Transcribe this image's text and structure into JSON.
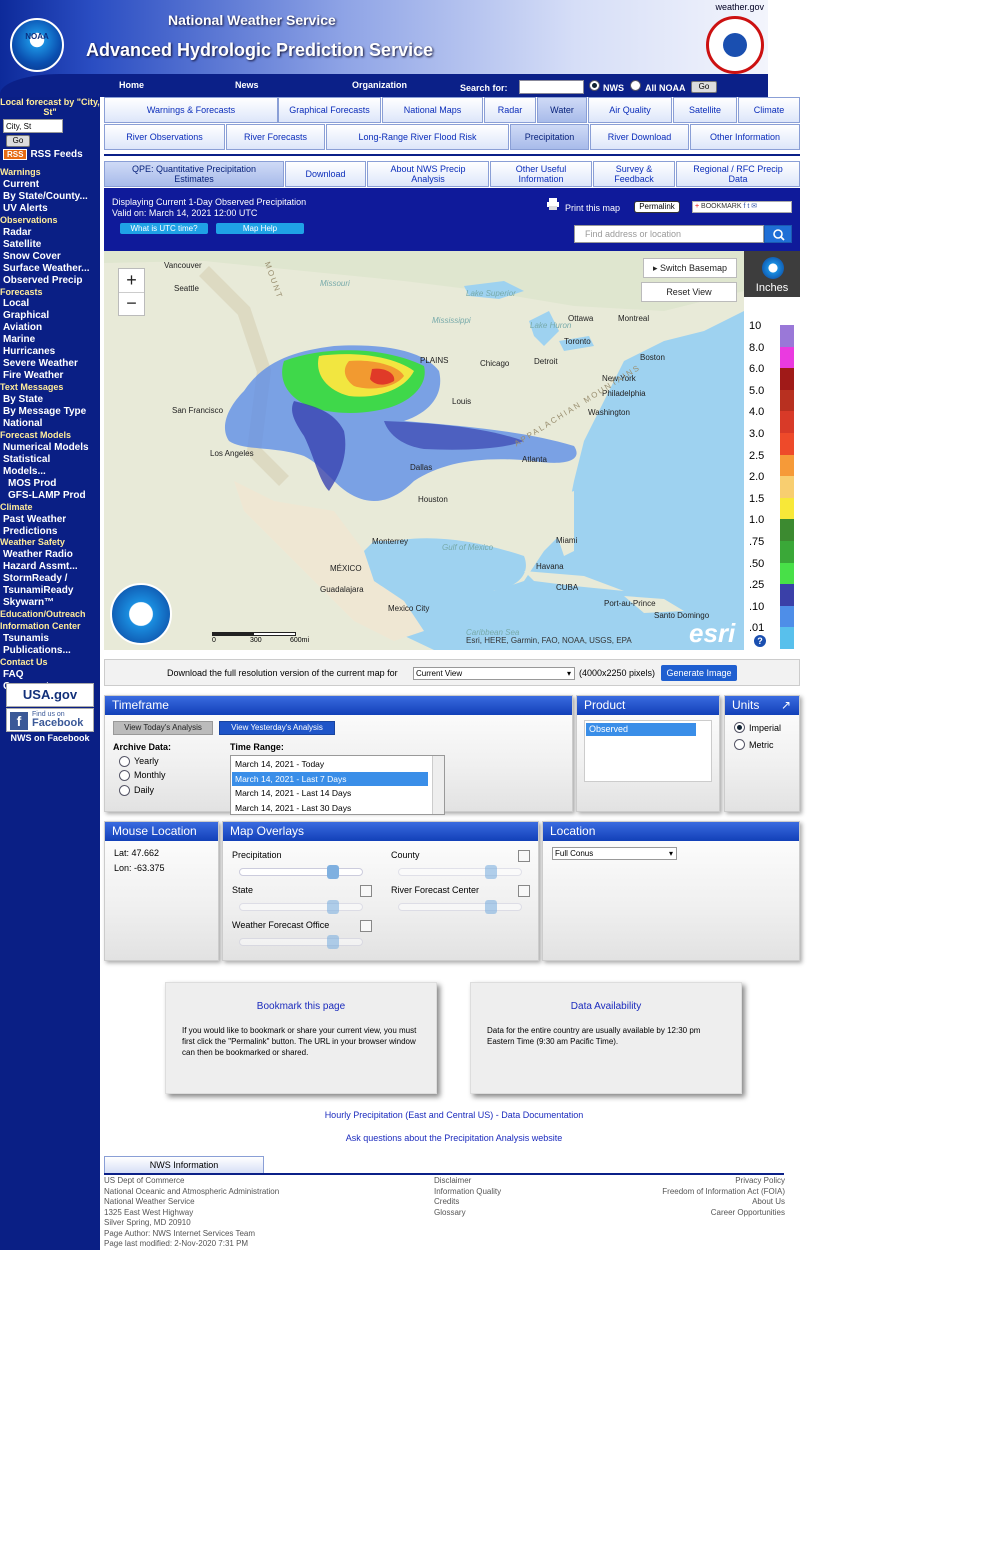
{
  "header": {
    "site": "weather.gov",
    "nws_title": "National Weather Service",
    "ahps_title": "Advanced Hydrologic Prediction Service",
    "noaa_logo_text": "NOAA",
    "nav": {
      "home": "Home",
      "news": "News",
      "organization": "Organization",
      "search_for": "Search for:",
      "nws": "NWS",
      "all_noaa": "All NOAA",
      "go": "Go"
    }
  },
  "sidebar": {
    "local_forecast": "Local forecast by \"City, St\"",
    "city_value": "City, St",
    "go": "Go",
    "rss_badge": "RSS",
    "rss_label": "RSS Feeds",
    "items": [
      {
        "type": "h",
        "label": "Warnings"
      },
      {
        "type": "i",
        "label": "Current"
      },
      {
        "type": "i",
        "label": "By State/County..."
      },
      {
        "type": "i",
        "label": "UV Alerts"
      },
      {
        "type": "h",
        "label": "Observations"
      },
      {
        "type": "i",
        "label": "Radar"
      },
      {
        "type": "i",
        "label": "Satellite"
      },
      {
        "type": "i",
        "label": "Snow Cover"
      },
      {
        "type": "i",
        "label": "Surface Weather..."
      },
      {
        "type": "i",
        "label": "Observed Precip"
      },
      {
        "type": "h",
        "label": "Forecasts"
      },
      {
        "type": "i",
        "label": "Local"
      },
      {
        "type": "i",
        "label": "Graphical"
      },
      {
        "type": "i",
        "label": "Aviation"
      },
      {
        "type": "i",
        "label": "Marine"
      },
      {
        "type": "i",
        "label": "Hurricanes"
      },
      {
        "type": "i",
        "label": "Severe Weather"
      },
      {
        "type": "i",
        "label": "Fire Weather"
      },
      {
        "type": "h",
        "label": "Text Messages"
      },
      {
        "type": "i",
        "label": "By State"
      },
      {
        "type": "i",
        "label": "By Message Type"
      },
      {
        "type": "i",
        "label": "National"
      },
      {
        "type": "h",
        "label": "Forecast Models"
      },
      {
        "type": "i",
        "label": "Numerical Models"
      },
      {
        "type": "i",
        "label": "Statistical"
      },
      {
        "type": "i",
        "label": "Models..."
      },
      {
        "type": "s",
        "label": "MOS Prod"
      },
      {
        "type": "s",
        "label": "GFS-LAMP Prod"
      },
      {
        "type": "h",
        "label": "Climate"
      },
      {
        "type": "i",
        "label": "Past Weather"
      },
      {
        "type": "i",
        "label": "Predictions"
      },
      {
        "type": "h",
        "label": "Weather Safety"
      },
      {
        "type": "i",
        "label": "Weather Radio"
      },
      {
        "type": "i",
        "label": "Hazard Assmt..."
      },
      {
        "type": "i",
        "label": "StormReady /"
      },
      {
        "type": "i",
        "label": "TsunamiReady"
      },
      {
        "type": "i",
        "label": "Skywarn™"
      },
      {
        "type": "h",
        "label": "Education/Outreach"
      },
      {
        "type": "h",
        "label": "Information Center"
      },
      {
        "type": "i",
        "label": "Tsunamis"
      },
      {
        "type": "i",
        "label": "Publications..."
      },
      {
        "type": "h",
        "label": "Contact Us"
      },
      {
        "type": "i",
        "label": "FAQ"
      },
      {
        "type": "i",
        "label": "Comments..."
      }
    ],
    "usagov": "USA.gov",
    "fb_find": "Find us on",
    "fb_name": "Facebook",
    "nws_facebook": "NWS on Facebook"
  },
  "tabs_row1": [
    "Warnings & Forecasts",
    "Graphical Forecasts",
    "National Maps",
    "Radar",
    "Water",
    "Air Quality",
    "Satellite",
    "Climate"
  ],
  "tabs_row2": [
    "River Observations",
    "River Forecasts",
    "Long-Range River Flood Risk",
    "Precipitation",
    "River Download",
    "Other Information"
  ],
  "subtabs": [
    "QPE: Quantitative Precipitation Estimates",
    "Download",
    "About NWS Precip Analysis",
    "Other Useful Information",
    "Survey & Feedback",
    "Regional / RFC Precip Data"
  ],
  "mapbar": {
    "line1": "Displaying Current 1-Day Observed Precipitation",
    "line2": "Valid on: March 14, 2021 12:00 UTC",
    "utc_btn": "What is UTC time?",
    "help_btn": "Map Help",
    "print": "Print this map",
    "permalink": "Permalink",
    "bookmark": "BOOKMARK",
    "find_placeholder": "Find address or location"
  },
  "map": {
    "switch_basemap": "Switch Basemap",
    "reset_view": "Reset View",
    "zoom_in": "+",
    "zoom_out": "−",
    "attribution": "Esri, HERE, Garmin, FAO, NOAA, USGS, EPA",
    "esri": "esri",
    "scale": [
      "0",
      "300",
      "600mi"
    ],
    "labels": [
      "Vancouver",
      "Seattle",
      "San Francisco",
      "Los Angeles",
      "Chicago",
      "Detroit",
      "Toronto",
      "Ottawa",
      "Montreal",
      "Boston",
      "New York",
      "Philadelphia",
      "Washington",
      "Atlanta",
      "Dallas",
      "Houston",
      "Monterrey",
      "MÉXICO",
      "Guadalajara",
      "Mexico City",
      "Miami",
      "Havana",
      "CUBA",
      "Port-au-Prince",
      "Santo Domingo",
      "Louis",
      "Missouri",
      "Lake Superior",
      "Lake Huron",
      "Gulf of Mexico",
      "Mississippi",
      "Caribbean Sea",
      "PLAINS",
      "APPALACHIAN MOUNTAINS",
      "MOUNT"
    ]
  },
  "legend": {
    "title": "Inches",
    "rows": [
      {
        "v": "10",
        "c": "#9a78d8"
      },
      {
        "v": "8.0",
        "c": "#ea3ae0"
      },
      {
        "v": "6.0",
        "c": "#a01a18"
      },
      {
        "v": "5.0",
        "c": "#b83020"
      },
      {
        "v": "4.0",
        "c": "#d83a28"
      },
      {
        "v": "3.0",
        "c": "#ee4a2a"
      },
      {
        "v": "2.5",
        "c": "#f69a38"
      },
      {
        "v": "2.0",
        "c": "#f8ce70"
      },
      {
        "v": "1.5",
        "c": "#f8e838"
      },
      {
        "v": "1.0",
        "c": "#3c8a30"
      },
      {
        "v": ".75",
        "c": "#3aa838"
      },
      {
        "v": ".50",
        "c": "#48e048"
      },
      {
        "v": ".25",
        "c": "#3a40a8"
      },
      {
        "v": ".10",
        "c": "#4e8ee8"
      },
      {
        "v": ".01",
        "c": "#58c0ec"
      }
    ]
  },
  "download": {
    "text": "Download the full resolution version of the current map for",
    "select": "Current View",
    "pixels": "(4000x2250 pixels)",
    "button": "Generate Image"
  },
  "timeframe": {
    "title": "Timeframe",
    "today_btn": "View Today's Analysis",
    "yesterday_btn": "View Yesterday's Analysis",
    "archive": "Archive Data:",
    "archive_opts": [
      "Yearly",
      "Monthly",
      "Daily"
    ],
    "range": "Time Range:",
    "range_opts": [
      "March 14, 2021 - Today",
      "March 14, 2021 - Last 7 Days",
      "March 14, 2021 - Last 14 Days",
      "March 14, 2021 - Last 30 Days"
    ]
  },
  "product": {
    "title": "Product",
    "selected": "Observed"
  },
  "units": {
    "title": "Units",
    "opts": [
      "Imperial",
      "Metric"
    ]
  },
  "mouse": {
    "title": "Mouse Location",
    "lat": "Lat: 47.662",
    "lon": "Lon: -63.375"
  },
  "overlays": {
    "title": "Map Overlays",
    "items": [
      "Precipitation",
      "County",
      "State",
      "River Forecast Center",
      "Weather Forecast Office"
    ]
  },
  "location": {
    "title": "Location",
    "select": "Full Conus"
  },
  "bookmark_box": {
    "title": "Bookmark this page",
    "body": "If you would like to bookmark or share your current view, you must first click the \"Permalink\" button. The URL in your browser window can then be bookmarked or shared."
  },
  "data_box": {
    "title": "Data Availability",
    "body": "Data for the entire country are usually available by 12:30 pm Eastern Time (9:30 am Pacific Time)."
  },
  "links": {
    "hourly": "Hourly Precipitation (East and Central US) - Data Documentation",
    "ask": "Ask questions about the Precipitation Analysis website"
  },
  "footer": {
    "tab": "NWS Information",
    "col1": [
      "US Dept of Commerce",
      "National Oceanic and Atmospheric Administration",
      "National Weather Service",
      "1325 East West Highway",
      "Silver Spring, MD 20910",
      "Page Author: NWS Internet Services Team",
      "Page last modified: 2-Nov-2020 7:31 PM"
    ],
    "col2": [
      "Disclaimer",
      "Information Quality",
      "Credits",
      "Glossary"
    ],
    "col3": [
      "Privacy Policy",
      "Freedom of Information Act (FOIA)",
      "About Us",
      "Career Opportunities"
    ]
  }
}
